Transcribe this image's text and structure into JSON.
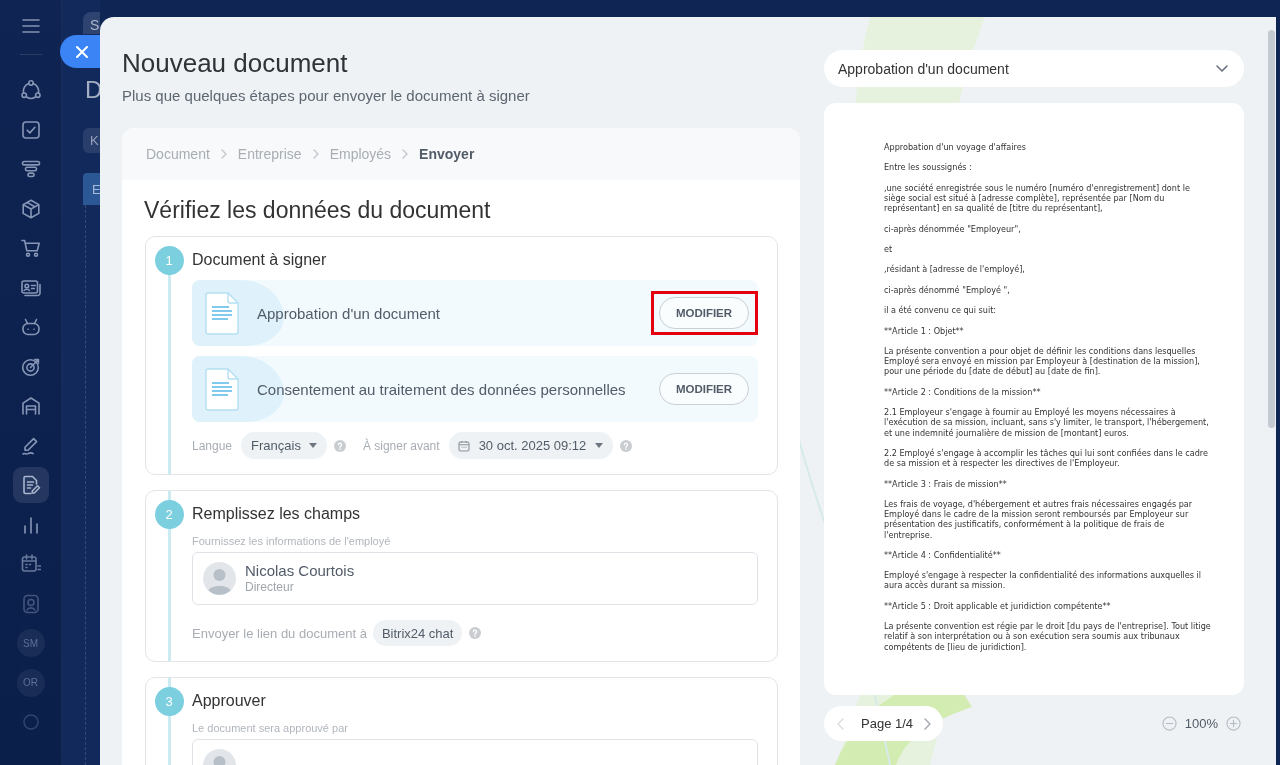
{
  "sidebar": {
    "items": [
      {
        "kind": "icon",
        "selected": false
      },
      {
        "kind": "icon",
        "selected": false
      },
      {
        "kind": "icon",
        "selected": false
      },
      {
        "kind": "icon",
        "selected": false
      },
      {
        "kind": "icon",
        "selected": false
      },
      {
        "kind": "icon",
        "selected": false
      },
      {
        "kind": "icon",
        "selected": false
      },
      {
        "kind": "icon",
        "selected": false
      },
      {
        "kind": "icon",
        "selected": false
      },
      {
        "kind": "icon",
        "selected": false
      },
      {
        "kind": "icon",
        "selected": true
      },
      {
        "kind": "icon",
        "selected": false
      },
      {
        "kind": "icon",
        "selected": false
      },
      {
        "kind": "icon",
        "selected": false
      },
      {
        "kind": "avatar",
        "label": "SM",
        "selected": false
      },
      {
        "kind": "avatar",
        "label": "OR",
        "selected": false
      },
      {
        "kind": "icon",
        "selected": false
      }
    ]
  },
  "background_page": {
    "search": {
      "placeholder": "S"
    },
    "title": "D",
    "button": "K",
    "tab": "E"
  },
  "panel": {
    "title": "Nouveau document",
    "subtitle": "Plus que quelques étapes pour envoyer le document à signer",
    "breadcrumb": [
      {
        "label": "Document",
        "selected": false
      },
      {
        "label": "Entreprise",
        "selected": false
      },
      {
        "label": "Employés",
        "selected": false
      },
      {
        "label": "Envoyer",
        "selected": true
      }
    ],
    "heading": "Vérifiez les données du document",
    "steps": [
      {
        "kind": "documents",
        "number": "1",
        "title": "Document à signer",
        "documents": [
          {
            "name": "Approbation d'un document",
            "button": "MODIFIER",
            "highlighted": true
          },
          {
            "name": "Consentement au traitement des données personnelles",
            "button": "MODIFIER",
            "highlighted": false
          }
        ],
        "language_label": "Langue",
        "language": "Français",
        "deadline_label": "À signer avant",
        "deadline": "30 oct. 2025 09:12"
      },
      {
        "kind": "people",
        "number": "2",
        "title": "Remplissez les champs",
        "hint": "Fournissez les informations de l'employé",
        "person": {
          "name": "Nicolas Courtois",
          "role": "Directeur"
        },
        "link_label": "Envoyer le lien du document à",
        "link_channel": "Bitrix24 chat"
      },
      {
        "kind": "people",
        "number": "3",
        "title": "Approuver",
        "hint": "Le document sera approuvé par"
      }
    ]
  },
  "preview": {
    "template": "Approbation d'un document",
    "paragraphs": [
      "Approbation d'un voyage d'affaires",
      "Entre les soussignés :",
      ",une société enregistrée sous le numéro [numéro d'enregistrement] dont le siège social est situé à [adresse complète], représentée par [Nom du représentant] en sa qualité de [titre du représentant],",
      "ci-après dénommée \"Employeur\",",
      "et",
      ",résidant à [adresse de l'employé],",
      "ci-après dénommé \"Employé \",",
      "il a été convenu ce qui suit:",
      "**Article 1 : Objet**",
      "La présente convention a pour objet de définir les conditions dans lesquelles Employé sera envoyé en mission par Employeur à [destination de la mission], pour une période du [date de début] au [date de fin].",
      "**Article 2 : Conditions de la mission**",
      "2.1 Employeur s'engage à fournir au Employé les moyens nécessaires à l'exécution de sa mission, incluant, sans s'y limiter, le transport, l'hébergement, et une indemnité journalière de mission de [montant] euros.",
      "2.2 Employé s'engage à accomplir les tâches qui lui sont confiées dans le cadre de sa mission et à respecter les directives de l'Employeur.",
      "**Article 3 : Frais de mission**",
      "Les frais de voyage, d'hébergement et autres frais nécessaires engagés par Employé dans le cadre de la mission seront remboursés par Employeur sur présentation des justificatifs, conformément à la politique de frais de l'entreprise.",
      "**Article 4 : Confidentialité**",
      "Employé s'engage à respecter la confidentialité des informations auxquelles il aura accès durant sa mission.",
      "**Article 5 : Droit applicable et juridiction compétente**",
      "La présente convention est régie par le droit [du pays de l'entreprise]. Tout litige relatif à son interprétation ou à son exécution sera soumis aux tribunaux compétents de [lieu de juridiction]."
    ],
    "pager": {
      "label": "Page 1/4",
      "prev_disabled": true,
      "next_disabled": false
    },
    "zoom": "100%"
  }
}
